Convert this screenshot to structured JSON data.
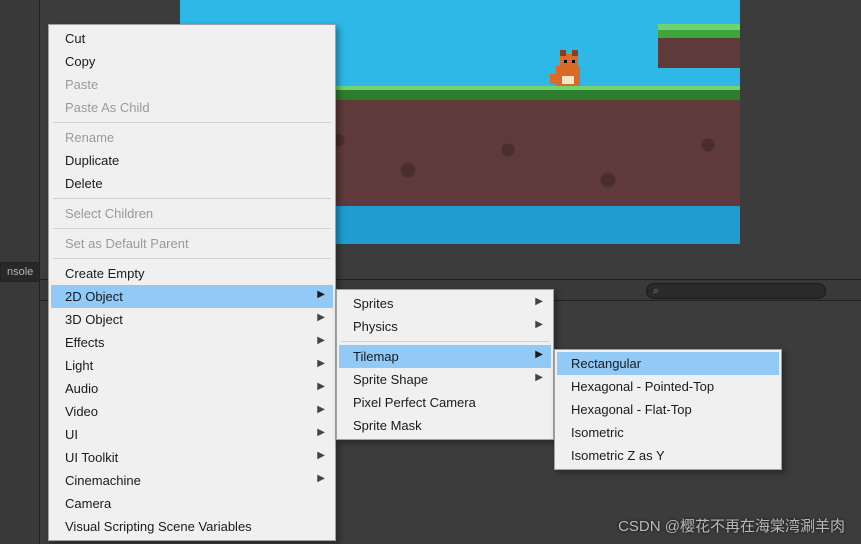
{
  "editor": {
    "left_panel_tab": "nsole",
    "search_placeholder": ""
  },
  "context_menu": {
    "items": [
      {
        "label": "Cut",
        "enabled": true,
        "submenu": false
      },
      {
        "label": "Copy",
        "enabled": true,
        "submenu": false
      },
      {
        "label": "Paste",
        "enabled": false,
        "submenu": false
      },
      {
        "label": "Paste As Child",
        "enabled": false,
        "submenu": false
      },
      {
        "sep": true
      },
      {
        "label": "Rename",
        "enabled": false,
        "submenu": false
      },
      {
        "label": "Duplicate",
        "enabled": true,
        "submenu": false
      },
      {
        "label": "Delete",
        "enabled": true,
        "submenu": false
      },
      {
        "sep": true
      },
      {
        "label": "Select Children",
        "enabled": false,
        "submenu": false
      },
      {
        "sep": true
      },
      {
        "label": "Set as Default Parent",
        "enabled": false,
        "submenu": false
      },
      {
        "sep": true
      },
      {
        "label": "Create Empty",
        "enabled": true,
        "submenu": false
      },
      {
        "label": "2D Object",
        "enabled": true,
        "submenu": true,
        "highlight": true
      },
      {
        "label": "3D Object",
        "enabled": true,
        "submenu": true
      },
      {
        "label": "Effects",
        "enabled": true,
        "submenu": true
      },
      {
        "label": "Light",
        "enabled": true,
        "submenu": true
      },
      {
        "label": "Audio",
        "enabled": true,
        "submenu": true
      },
      {
        "label": "Video",
        "enabled": true,
        "submenu": true
      },
      {
        "label": "UI",
        "enabled": true,
        "submenu": true
      },
      {
        "label": "UI Toolkit",
        "enabled": true,
        "submenu": true
      },
      {
        "label": "Cinemachine",
        "enabled": true,
        "submenu": true
      },
      {
        "label": "Camera",
        "enabled": true,
        "submenu": false
      },
      {
        "label": "Visual Scripting Scene Variables",
        "enabled": true,
        "submenu": false
      }
    ]
  },
  "submenu_2d_object": {
    "items": [
      {
        "label": "Sprites",
        "submenu": true
      },
      {
        "label": "Physics",
        "submenu": true
      },
      {
        "sep": true
      },
      {
        "label": "Tilemap",
        "submenu": true,
        "highlight": true
      },
      {
        "label": "Sprite Shape",
        "submenu": true
      },
      {
        "label": "Pixel Perfect Camera",
        "submenu": false
      },
      {
        "label": "Sprite Mask",
        "submenu": false
      }
    ]
  },
  "submenu_tilemap": {
    "items": [
      {
        "label": "Rectangular",
        "highlight": true
      },
      {
        "label": "Hexagonal - Pointed-Top"
      },
      {
        "label": "Hexagonal - Flat-Top"
      },
      {
        "label": "Isometric"
      },
      {
        "label": "Isometric Z as Y"
      }
    ]
  },
  "watermark": "CSDN @樱花不再在海棠湾涮羊肉"
}
